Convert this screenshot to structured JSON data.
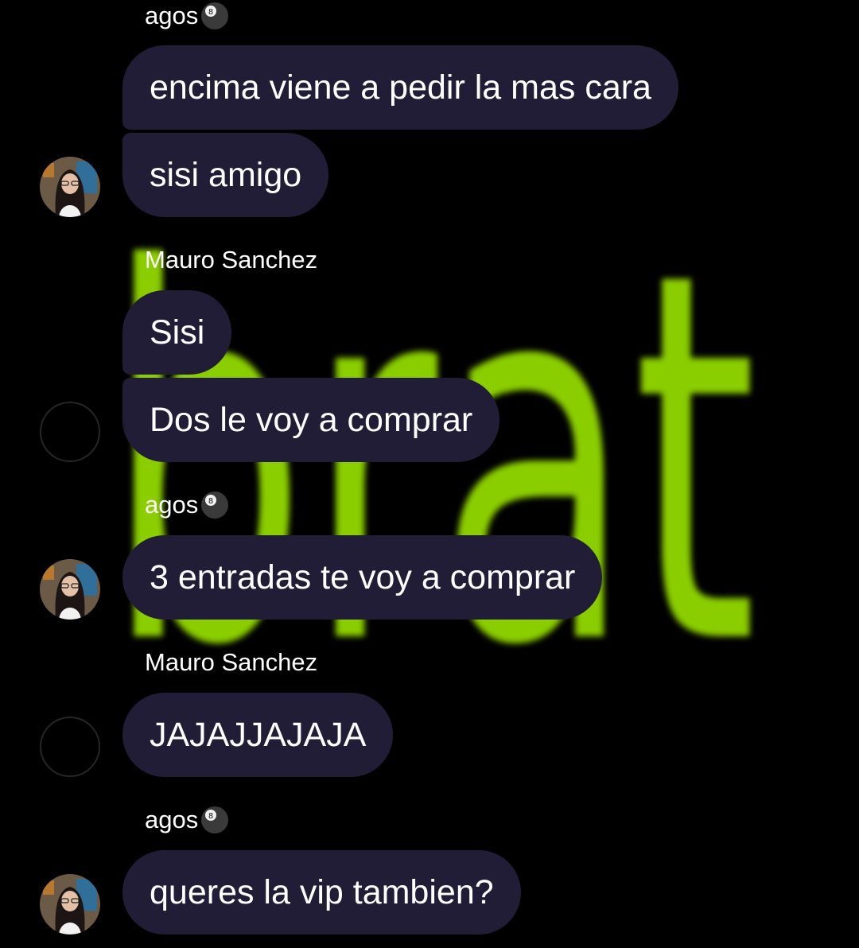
{
  "wallpaper": {
    "text": "brat",
    "color": "#8ace00"
  },
  "theme": {
    "bubble_color": "#221d37",
    "background": "#000000"
  },
  "messages": [
    {
      "sender": "agos",
      "sender_icon": "eight-ball-icon",
      "texts": [
        "encima viene a pedir la mas cara",
        "sisi amigo"
      ]
    },
    {
      "sender": "Mauro Sanchez",
      "texts": [
        "Sisi",
        "Dos le voy a comprar"
      ]
    },
    {
      "sender": "agos",
      "sender_icon": "eight-ball-icon",
      "texts": [
        "3 entradas te voy a comprar"
      ]
    },
    {
      "sender": "Mauro Sanchez",
      "texts": [
        "JAJAJJAJAJA"
      ]
    },
    {
      "sender": "agos",
      "sender_icon": "eight-ball-icon",
      "texts": [
        "queres la vip tambien?"
      ]
    }
  ]
}
